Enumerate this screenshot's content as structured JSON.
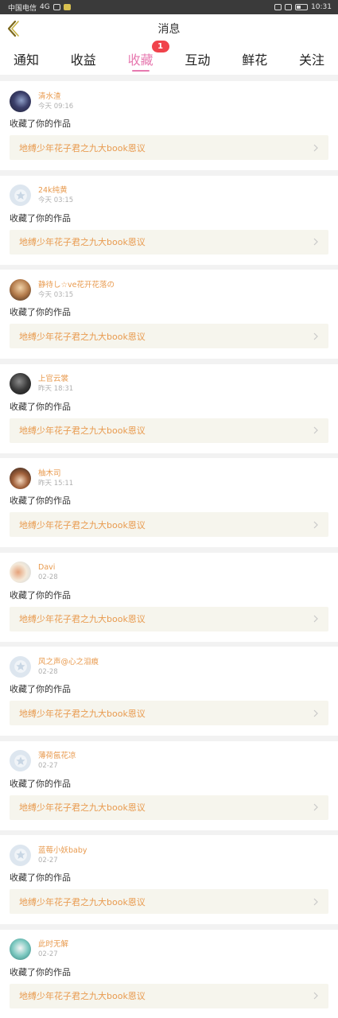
{
  "status_bar": {
    "carrier": "中国电信",
    "network": "4G",
    "time": "10:31"
  },
  "header": {
    "title": "消息"
  },
  "tabs": [
    {
      "label": "通知"
    },
    {
      "label": "收益"
    },
    {
      "label": "收藏",
      "badge": "1",
      "active": true
    },
    {
      "label": "互动"
    },
    {
      "label": "鲜花"
    },
    {
      "label": "关注"
    }
  ],
  "colors": {
    "accent": "#e77ab0",
    "badge": "#f0434b",
    "username": "#e89a4e",
    "work_bg": "#f6f5ed"
  },
  "items": [
    {
      "username": "清水渣",
      "time": "今天 09:16",
      "action": "收藏了你的作品",
      "work": "地缚少年花子君之九大book恩议",
      "avatar": "photo-dark-blue"
    },
    {
      "username": "24k纯黄",
      "time": "今天 03:15",
      "action": "收藏了你的作品",
      "work": "地缚少年花子君之九大book恩议",
      "avatar": "default-star"
    },
    {
      "username": "静待し☆ve花开花落の",
      "time": "今天 03:15",
      "action": "收藏了你的作品",
      "work": "地缚少年花子君之九大book恩议",
      "avatar": "photo-brown"
    },
    {
      "username": "上官云裳",
      "time": "昨天 18:31",
      "action": "收藏了你的作品",
      "work": "地缚少年花子君之九大book恩议",
      "avatar": "photo-dark"
    },
    {
      "username": "柚木司",
      "time": "昨天 15:11",
      "action": "收藏了你的作品",
      "work": "地缚少年花子君之九大book恩议",
      "avatar": "photo-anime"
    },
    {
      "username": "Davi",
      "time": "02-28",
      "action": "收藏了你的作品",
      "work": "地缚少年花子君之九大book恩议",
      "avatar": "photo-light"
    },
    {
      "username": "风之声@心之泪痕",
      "time": "02-28",
      "action": "收藏了你的作品",
      "work": "地缚少年花子君之九大book恩议",
      "avatar": "default-star"
    },
    {
      "username": "薄荷氤花凉",
      "time": "02-27",
      "action": "收藏了你的作品",
      "work": "地缚少年花子君之九大book恩议",
      "avatar": "default-star"
    },
    {
      "username": "蓝莓小妖baby",
      "time": "02-27",
      "action": "收藏了你的作品",
      "work": "地缚少年花子君之九大book恩议",
      "avatar": "default-star"
    },
    {
      "username": "此时无解",
      "time": "02-27",
      "action": "收藏了你的作品",
      "work": "地缚少年花子君之九大book恩议",
      "avatar": "photo-teal"
    }
  ]
}
